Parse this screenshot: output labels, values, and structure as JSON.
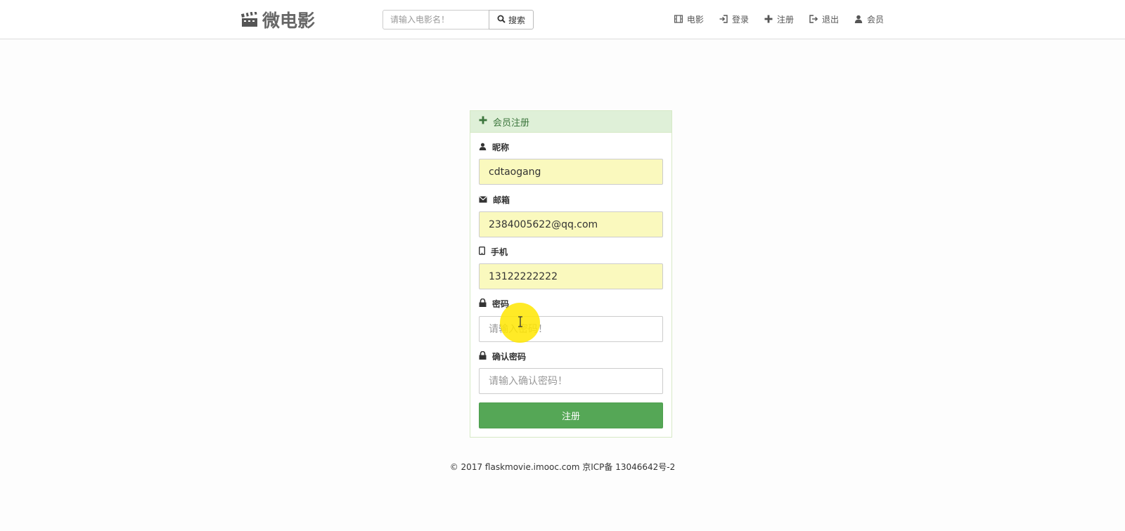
{
  "header": {
    "brand": "微电影",
    "brand_icon": "film-clapper-icon",
    "search": {
      "placeholder": "请输入电影名！",
      "value": "",
      "button_label": "搜索"
    },
    "nav": [
      {
        "label": "电影",
        "icon": "film-icon"
      },
      {
        "label": "登录",
        "icon": "login-icon"
      },
      {
        "label": "注册",
        "icon": "plus-icon"
      },
      {
        "label": "退出",
        "icon": "logout-icon"
      },
      {
        "label": "会员",
        "icon": "user-icon"
      }
    ]
  },
  "form": {
    "title": "会员注册",
    "fields": [
      {
        "label": "昵称",
        "icon": "user-icon",
        "value": "cdtaogang",
        "placeholder": ""
      },
      {
        "label": "邮箱",
        "icon": "envelope-icon",
        "value": "2384005622@qq.com",
        "placeholder": ""
      },
      {
        "label": "手机",
        "icon": "phone-icon",
        "value": "13122222222",
        "placeholder": ""
      },
      {
        "label": "密码",
        "icon": "lock-icon",
        "value": "",
        "placeholder": "请输入密码！"
      },
      {
        "label": "确认密码",
        "icon": "lock-icon",
        "value": "",
        "placeholder": "请输入确认密码！"
      }
    ],
    "submit_label": "注册"
  },
  "footer": {
    "text": "© 2017 flaskmovie.imooc.com 京ICP备 13046642号-2"
  },
  "colors": {
    "panel_heading_bg": "#dff0d8",
    "panel_heading_text": "#3c763d",
    "autofill_bg": "#faf9be",
    "submit_bg": "#55a756",
    "cursor_highlight": "#ffe600"
  }
}
